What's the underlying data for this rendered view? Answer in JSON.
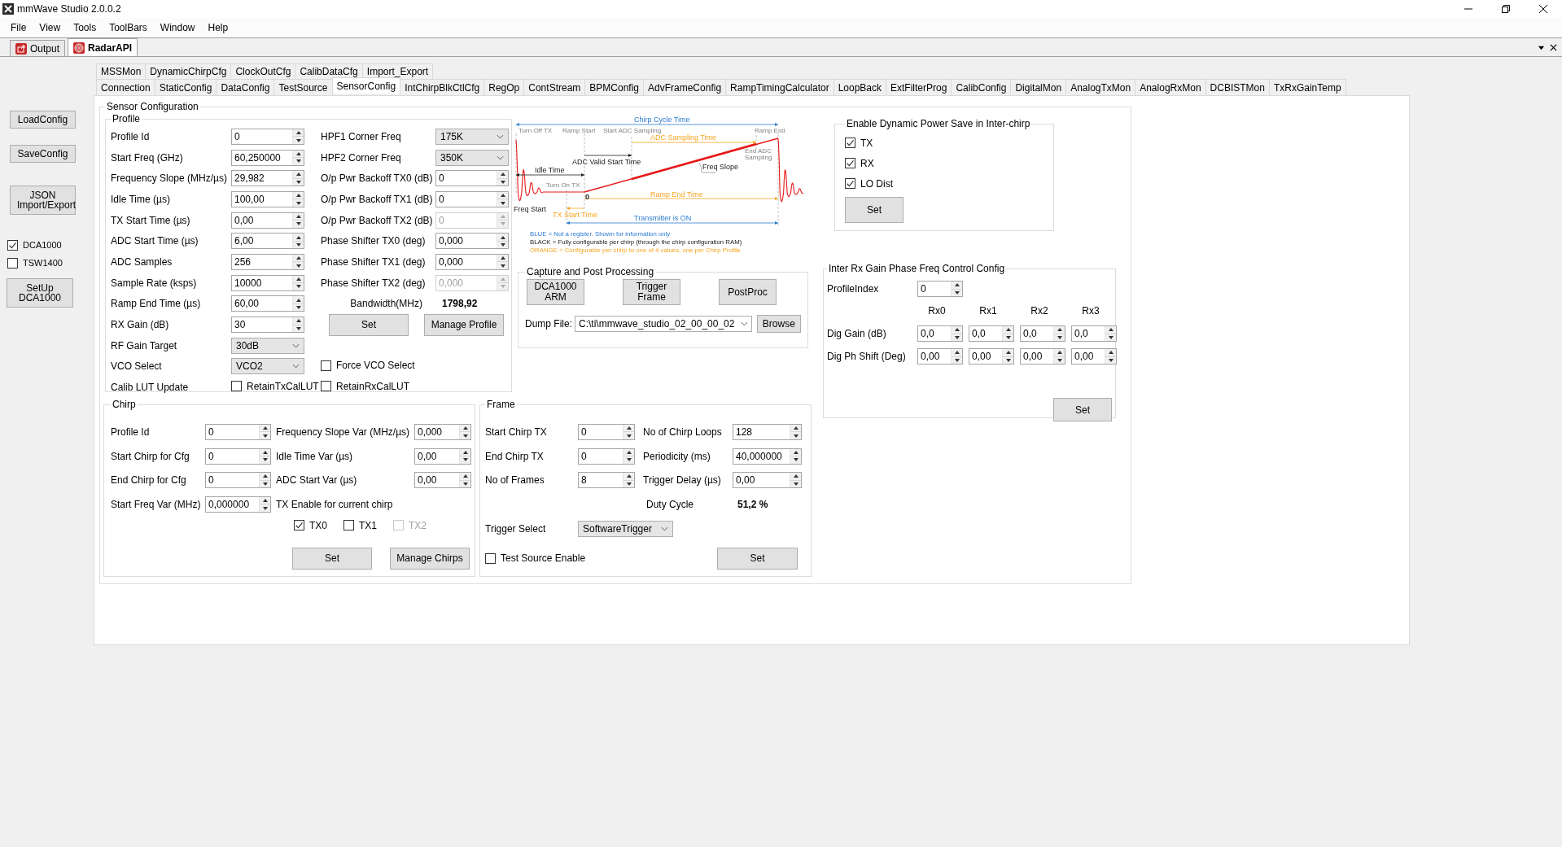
{
  "window": {
    "title": "mmWave Studio 2.0.0.2"
  },
  "menu": [
    "File",
    "View",
    "Tools",
    "ToolBars",
    "Window",
    "Help"
  ],
  "doc_tabs": [
    {
      "label": "Output",
      "selected": false
    },
    {
      "label": "RadarAPI",
      "selected": true
    }
  ],
  "sidebar": {
    "buttons": [
      "LoadConfig",
      "SaveConfig",
      "JSON Import/Export"
    ],
    "checks": [
      {
        "label": "DCA1000",
        "checked": true
      },
      {
        "label": "TSW1400",
        "checked": false
      }
    ],
    "setup_button": "SetUp DCA1000"
  },
  "tab_rows": [
    [
      {
        "label": "MSSMon",
        "selected": false
      },
      {
        "label": "DynamicChirpCfg",
        "selected": false
      },
      {
        "label": "ClockOutCfg",
        "selected": false
      },
      {
        "label": "CalibDataCfg",
        "selected": false
      },
      {
        "label": "Import_Export",
        "selected": false
      }
    ],
    [
      {
        "label": "Connection",
        "selected": false
      },
      {
        "label": "StaticConfig",
        "selected": false
      },
      {
        "label": "DataConfig",
        "selected": false
      },
      {
        "label": "TestSource",
        "selected": false
      },
      {
        "label": "SensorConfig",
        "selected": true
      },
      {
        "label": "IntChirpBlkCtlCfg",
        "selected": false
      },
      {
        "label": "RegOp",
        "selected": false
      },
      {
        "label": "ContStream",
        "selected": false
      },
      {
        "label": "BPMConfig",
        "selected": false
      },
      {
        "label": "AdvFrameConfig",
        "selected": false
      },
      {
        "label": "RampTimingCalculator",
        "selected": false
      },
      {
        "label": "LoopBack",
        "selected": false
      },
      {
        "label": "ExtFilterProg",
        "selected": false
      },
      {
        "label": "CalibConfig",
        "selected": false
      },
      {
        "label": "DigitalMon",
        "selected": false
      },
      {
        "label": "AnalogTxMon",
        "selected": false
      },
      {
        "label": "AnalogRxMon",
        "selected": false
      },
      {
        "label": "DCBISTMon",
        "selected": false
      },
      {
        "label": "TxRxGainTemp",
        "selected": false
      }
    ]
  ],
  "sensor_config": {
    "title": "Sensor Configuration",
    "profile": {
      "title": "Profile",
      "left": [
        {
          "label": "Profile Id",
          "value": "0",
          "kind": "spin"
        },
        {
          "label": "Start Freq (GHz)",
          "value": "60,250000",
          "kind": "spin"
        },
        {
          "label": "Frequency Slope (MHz/µs)",
          "value": "29,982",
          "kind": "spin"
        },
        {
          "label": "Idle Time (µs)",
          "value": "100,00",
          "kind": "spin"
        },
        {
          "label": "TX Start Time (µs)",
          "value": "0,00",
          "kind": "spin"
        },
        {
          "label": "ADC Start Time (µs)",
          "value": "6,00",
          "kind": "spin"
        },
        {
          "label": "ADC Samples",
          "value": "256",
          "kind": "spin"
        },
        {
          "label": "Sample Rate (ksps)",
          "value": "10000",
          "kind": "spin"
        },
        {
          "label": "Ramp End Time (µs)",
          "value": "60,00",
          "kind": "spin"
        },
        {
          "label": "RX Gain (dB)",
          "value": "30",
          "kind": "spin"
        },
        {
          "label": "RF Gain Target",
          "value": "30dB",
          "kind": "combo"
        },
        {
          "label": "VCO Select",
          "value": "VCO2",
          "kind": "combo"
        }
      ],
      "right": [
        {
          "label": "HPF1 Corner Freq",
          "value": "175K",
          "kind": "combo",
          "disabled": false
        },
        {
          "label": "HPF2 Corner Freq",
          "value": "350K",
          "kind": "combo",
          "disabled": false
        },
        {
          "label": "O/p Pwr Backoff TX0 (dB)",
          "value": "0",
          "kind": "spin",
          "disabled": false
        },
        {
          "label": "O/p Pwr Backoff TX1 (dB)",
          "value": "0",
          "kind": "spin",
          "disabled": false
        },
        {
          "label": "O/p Pwr Backoff TX2 (dB)",
          "value": "0",
          "kind": "spin",
          "disabled": true
        },
        {
          "label": "Phase Shifter TX0 (deg)",
          "value": "0,000",
          "kind": "spin",
          "disabled": false
        },
        {
          "label": "Phase Shifter TX1 (deg)",
          "value": "0,000",
          "kind": "spin",
          "disabled": false
        },
        {
          "label": "Phase Shifter TX2 (deg)",
          "value": "0,000",
          "kind": "spin",
          "disabled": true
        }
      ],
      "bandwidth": {
        "label": "Bandwidth(MHz)",
        "value": "1798,92"
      },
      "buttons": [
        "Set",
        "Manage Profile"
      ],
      "force_vco": {
        "label": "Force VCO Select",
        "checked": false
      },
      "calib_lut": {
        "label": "Calib LUT Update",
        "options": [
          {
            "label": "RetainTxCalLUT",
            "checked": false
          },
          {
            "label": "RetainRxCalLUT",
            "checked": false
          }
        ]
      }
    },
    "diagram": {
      "labels": [
        {
          "text": "Chirp Cycle Time",
          "kind": "info"
        },
        {
          "text": "Turn Off TX",
          "kind": "marker"
        },
        {
          "text": "Ramp Start",
          "kind": "marker"
        },
        {
          "text": "Start ADC Sampling",
          "kind": "marker"
        },
        {
          "text": "Ramp End",
          "kind": "marker"
        },
        {
          "text": "ADC Sampling Time",
          "kind": "profile"
        },
        {
          "text": "End ADC",
          "kind": "marker"
        },
        {
          "text": "Sampling",
          "kind": "marker"
        },
        {
          "text": "ADC Valid Start Time",
          "kind": "chirp"
        },
        {
          "text": "Freq Slope",
          "kind": "chirp"
        },
        {
          "text": "Idle Time",
          "kind": "chirp"
        },
        {
          "text": "Turn On TX",
          "kind": "marker"
        },
        {
          "text": "0",
          "kind": "chirp"
        },
        {
          "text": "Ramp End Time",
          "kind": "profile"
        },
        {
          "text": "Freq Start",
          "kind": "chirp"
        },
        {
          "text": "TX Start Time",
          "kind": "profile"
        },
        {
          "text": "Transmitter is ON",
          "kind": "info"
        }
      ],
      "legend": [
        {
          "text": "BLUE = Not a register. Shown for information only",
          "kind": "info"
        },
        {
          "text": "BLACK = Fully configurable per chirp (through the chirp configuration RAM)",
          "kind": "chirp"
        },
        {
          "text": "ORANGE = Configurable per chirp to one of 4 values, one per Chirp Profile",
          "kind": "profile"
        }
      ]
    },
    "capture": {
      "title": "Capture and Post Processing",
      "buttons": [
        "DCA1000 ARM",
        "Trigger Frame",
        "PostProc"
      ],
      "dump_file": {
        "label": "Dump File:",
        "value": "C:\\ti\\mmwave_studio_02_00_00_02"
      },
      "browse": "Browse"
    },
    "power_save": {
      "title": "Enable Dynamic Power Save in Inter-chirp",
      "options": [
        {
          "label": "TX",
          "checked": true
        },
        {
          "label": "RX",
          "checked": true
        },
        {
          "label": "LO Dist",
          "checked": true
        }
      ],
      "button": "Set"
    },
    "inter_rx": {
      "title": "Inter Rx Gain Phase Freq Control Config",
      "profile_index": {
        "label": "ProfileIndex",
        "value": "0"
      },
      "columns": [
        "Rx0",
        "Rx1",
        "Rx2",
        "Rx3"
      ],
      "rows": [
        {
          "label": "Dig Gain (dB)",
          "values": [
            "0,0",
            "0,0",
            "0,0",
            "0,0"
          ]
        },
        {
          "label": "Dig Ph Shift (Deg)",
          "values": [
            "0,00",
            "0,00",
            "0,00",
            "0,00"
          ]
        }
      ],
      "button": "Set"
    },
    "chirp": {
      "title": "Chirp",
      "left": [
        {
          "label": "Profile Id",
          "value": "0"
        },
        {
          "label": "Start Chirp for Cfg",
          "value": "0"
        },
        {
          "label": "End Chirp for Cfg",
          "value": "0"
        },
        {
          "label": "Start Freq Var (MHz)",
          "value": "0,000000"
        }
      ],
      "right": [
        {
          "label": "Frequency Slope Var (MHz/µs)",
          "value": "0,000"
        },
        {
          "label": "Idle Time Var (µs)",
          "value": "0,00"
        },
        {
          "label": "ADC Start Var (µs)",
          "value": "0,00"
        }
      ],
      "tx_enable": {
        "label": "TX Enable for current chirp",
        "options": [
          {
            "label": "TX0",
            "checked": true,
            "disabled": false
          },
          {
            "label": "TX1",
            "checked": false,
            "disabled": false
          },
          {
            "label": "TX2",
            "checked": false,
            "disabled": true
          }
        ]
      },
      "buttons": [
        "Set",
        "Manage Chirps"
      ]
    },
    "frame": {
      "title": "Frame",
      "left": [
        {
          "label": "Start Chirp TX",
          "value": "0"
        },
        {
          "label": "End Chirp TX",
          "value": "0"
        },
        {
          "label": "No of Frames",
          "value": "8"
        }
      ],
      "right": [
        {
          "label": "No of Chirp Loops",
          "value": "128"
        },
        {
          "label": "Periodicity (ms)",
          "value": "40,000000"
        },
        {
          "label": "Trigger Delay (µs)",
          "value": "0,00"
        }
      ],
      "duty_cycle": {
        "label": "Duty Cycle",
        "value": "51,2 %"
      },
      "trigger_select": {
        "label": "Trigger Select",
        "value": "SoftwareTrigger"
      },
      "test_source": {
        "label": "Test Source Enable",
        "checked": false
      },
      "button": "Set"
    }
  }
}
